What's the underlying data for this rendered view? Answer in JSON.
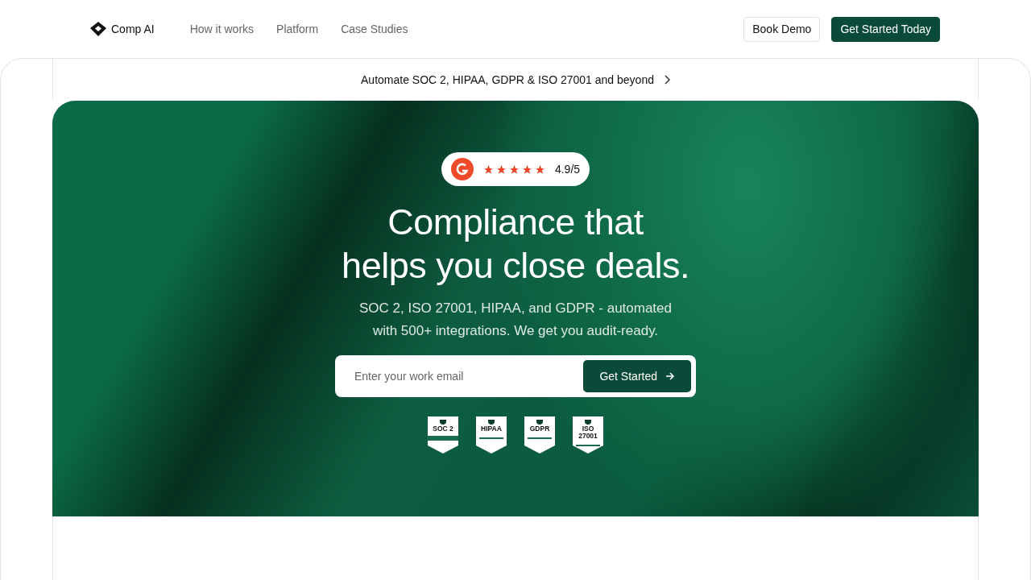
{
  "nav": {
    "brand": "Comp AI",
    "links": [
      "How it works",
      "Platform",
      "Case Studies"
    ],
    "buttons": [
      {
        "label": "Book Demo",
        "kind": "outline"
      },
      {
        "label": "Get Started Today",
        "kind": "solid"
      }
    ]
  },
  "announcement": {
    "text": "Automate SOC 2, HIPAA, GDPR & ISO 27001 and beyond"
  },
  "hero": {
    "rating": {
      "stars": 5,
      "score": "4.9/5"
    },
    "headline": [
      "Compliance that",
      "helps you close deals."
    ],
    "subtitle": [
      "SOC 2, ISO 27001, HIPAA, and GDPR - automated",
      "with 500+ integrations. We get you audit-ready."
    ],
    "email": {
      "placeholder": "Enter your work email",
      "button": "Get Started"
    },
    "badges": [
      {
        "label": "SOC 2",
        "kind": "band"
      },
      {
        "label": "HIPAA",
        "kind": "plain"
      },
      {
        "label": "GDPR",
        "kind": "plain"
      },
      {
        "label": "ISO 27001",
        "kind": "plain"
      }
    ]
  }
}
